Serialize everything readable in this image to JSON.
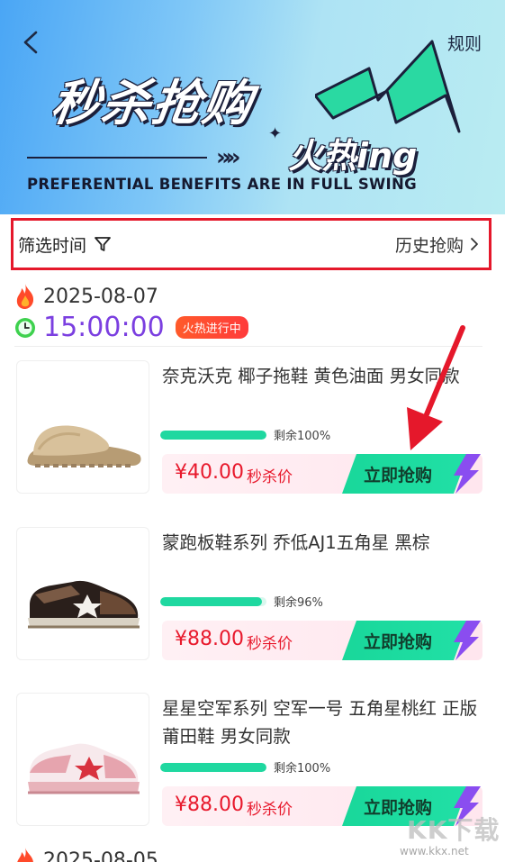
{
  "header": {
    "rules_label": "规则",
    "title": "秒杀抢购",
    "subtitle_hot": "火热ing",
    "subtitle_en": "PREFERENTIAL BENEFITS ARE IN FULL SWING",
    "chevrons": "»»"
  },
  "filter": {
    "label": "筛选时间",
    "history_label": "历史抢购"
  },
  "session": {
    "date": "2025-08-07",
    "time": "15:00:00",
    "status_badge": "火热进行中"
  },
  "products": [
    {
      "name": "奈克沃克 椰子拖鞋 黄色油面 男女同款",
      "stock_label": "剩余100%",
      "stock_fraction": 1.0,
      "price": "¥40.00",
      "price_tag": "秒杀价",
      "buy_label": "立即抢购",
      "image_icon": "slide-sandal-image"
    },
    {
      "name": "蒙跑板鞋系列 乔低AJ1五角星 黑棕",
      "stock_label": "剩余96%",
      "stock_fraction": 0.96,
      "price": "¥88.00",
      "price_tag": "秒杀价",
      "buy_label": "立即抢购",
      "image_icon": "brown-sneaker-image"
    },
    {
      "name": "星星空军系列 空军一号 五角星桃红 正版莆田鞋 男女同款",
      "stock_label": "剩余100%",
      "stock_fraction": 1.0,
      "price": "¥88.00",
      "price_tag": "秒杀价",
      "buy_label": "立即抢购",
      "image_icon": "pink-sneaker-image"
    }
  ],
  "next_session": {
    "date": "2025-08-05"
  },
  "watermark": {
    "brand": "KK下载",
    "url": "www.kkx.net"
  },
  "colors": {
    "accent_green": "#1fd8a0",
    "price_red": "#e8192c",
    "time_purple": "#7b3fe0",
    "highlight_red": "#e5182b"
  }
}
